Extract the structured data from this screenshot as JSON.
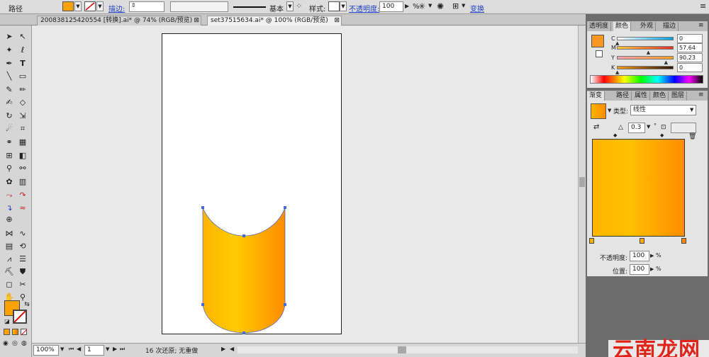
{
  "control_bar": {
    "object_type": "路径",
    "fill_color": "#ffa200",
    "stroke_label": "描边:",
    "stroke_weight": "",
    "stroke_profile": "基本",
    "style_label": "样式:",
    "opacity_label": "不透明度:",
    "opacity_value": "100",
    "percent": "%",
    "transform_label": "变换"
  },
  "tabs": [
    {
      "label": "200838125420554 [转换].ai* @ 74% (RGB/预览)",
      "close": "⊠"
    },
    {
      "label": "set37515634.ai* @ 100% (RGB/预览)",
      "close": "⊠"
    }
  ],
  "color_panel": {
    "tabs": [
      "透明度",
      "颜色",
      "外观",
      "描边"
    ],
    "current_color": "#f89820",
    "channels": [
      {
        "name": "C",
        "value": "0",
        "fraction": 0.0,
        "gradient": "linear-gradient(to right,#ffffff,#00a0e0)"
      },
      {
        "name": "M",
        "value": "57.64",
        "fraction": 0.5764,
        "gradient": "linear-gradient(to right,#f8c63a,#e0322a)"
      },
      {
        "name": "Y",
        "value": "90.23",
        "fraction": 0.9023,
        "gradient": "linear-gradient(to right,#f8a0a8,#f8a020)"
      },
      {
        "name": "K",
        "value": "0",
        "fraction": 0.0,
        "gradient": "linear-gradient(to right,#f49a1e,#2a1508)"
      }
    ]
  },
  "gradient_panel": {
    "tabs": [
      "渐变",
      "路径",
      "属性",
      "颜色",
      "图层"
    ],
    "type_label": "类型:",
    "type_value": "线性",
    "angle_value": "0.3",
    "degree": "°",
    "stop_start": "#ffb400",
    "stop_end": "#ff8c00",
    "opacity_label": "不透明度:",
    "opacity_value": "100",
    "position_label": "位置:",
    "position_value": "100",
    "percent": "%"
  },
  "status_bar": {
    "zoom": "100%",
    "artboard": "1",
    "info": "16 次还原; 无重做"
  },
  "watermark": "云南龙网",
  "colors": {
    "shape_left": "#ffb400",
    "shape_mid": "#ffc800",
    "shape_right": "#ff8c00",
    "anchor": "#4a6cd0"
  }
}
